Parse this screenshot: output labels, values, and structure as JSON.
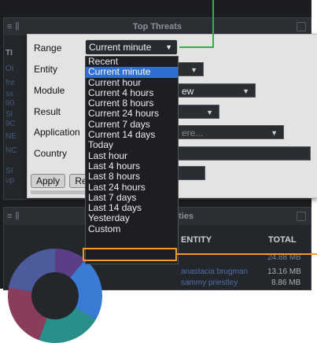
{
  "top_threats_panel": {
    "title": "Top Threats",
    "bg_rows": [
      "TI",
      "Ot",
      "fre",
      "ss",
      "90",
      "Sl",
      "9C",
      "NE",
      "NC",
      "SI",
      "up"
    ]
  },
  "filters": {
    "range_label": "Range",
    "entity_label": "Entity",
    "module_label": "Module",
    "result_label": "Result",
    "application_label": "Application",
    "country_label": "Country",
    "module_value": "ew",
    "application_placeholder": "ere...",
    "apply_label": "Apply",
    "reset_label": "Re"
  },
  "range_select": {
    "value": "Current minute",
    "options": [
      "Recent",
      "Current minute",
      "Current hour",
      "Current 4 hours",
      "Current 8 hours",
      "Current 24 hours",
      "Current 7 days",
      "Current 14 days",
      "Today",
      "Last hour",
      "Last 4 hours",
      "Last 8 hours",
      "Last 24 hours",
      "Last 7 days",
      "Last 14 days",
      "Yesterday",
      "Custom"
    ],
    "selected_index": 1,
    "highlighted_option": "Custom"
  },
  "top_entities_panel": {
    "title_fragment": "ties",
    "col_entity": "ENTITY",
    "col_total": "TOTAL",
    "rows": [
      {
        "entity": "",
        "total": "24.88 MB"
      },
      {
        "entity": "anastacia brugman",
        "total": "13.16 MB"
      },
      {
        "entity": "sammy priestley",
        "total": "8.86 MB"
      }
    ]
  },
  "colors": {
    "selected_option": "#2f6fd1",
    "highlight_box": "#f39b24",
    "callout_line": "#2bb34a"
  }
}
